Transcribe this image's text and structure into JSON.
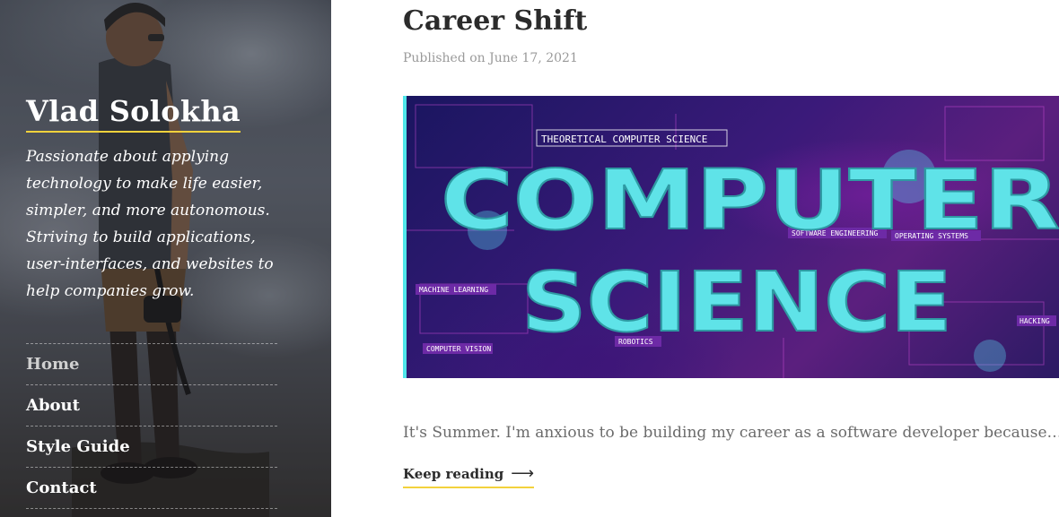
{
  "sidebar": {
    "site_title": "Vlad Solokha",
    "tagline": "Passionate about applying technology to make life easier, simpler, and more autonomous. Striving to build applications, user-interfaces, and websites to help companies grow.",
    "nav": [
      {
        "label": "Home",
        "active": true
      },
      {
        "label": "About",
        "active": false
      },
      {
        "label": "Style Guide",
        "active": false
      },
      {
        "label": "Contact",
        "active": false
      }
    ]
  },
  "post": {
    "title": "Career Shift",
    "date": "Published on June 17, 2021",
    "image": {
      "word1": "COMPUTER",
      "word2": "SCIENCE",
      "banner": "THEORETICAL COMPUTER SCIENCE",
      "labels": [
        "MACHINE LEARNING",
        "COMPUTER VISION",
        "SOFTWARE ENGINEERING",
        "OPERATING SYSTEMS",
        "ROBOTICS",
        "HACKING"
      ]
    },
    "excerpt": "It's Summer. I'm anxious to be building my career as a software developer because…",
    "keep_reading": "Keep reading",
    "arrow": "⟶"
  },
  "colors": {
    "accent_underline": "#f3d23c",
    "hero_text": "#5fe3e8",
    "hero_bg": "#3b1a7a"
  }
}
